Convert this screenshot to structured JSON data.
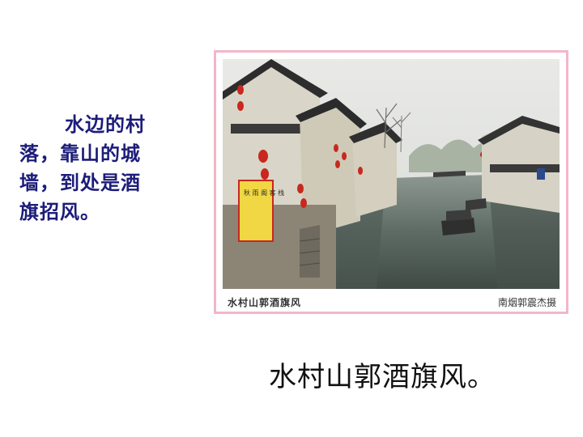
{
  "side_text": {
    "line1": "水边的村",
    "line2": "落，靠山的城",
    "line3": "墙，到处是酒",
    "line4": "旗招风。"
  },
  "photo": {
    "caption_left": "水村山郭酒旗风",
    "caption_right": "南烟郭震杰摄",
    "banner_text": "秋 雨 阁 客 栈"
  },
  "main_caption": "水村山郭酒旗风。",
  "colors": {
    "side_text": "#1c1c7a",
    "frame_border": "#f3b6c9"
  }
}
